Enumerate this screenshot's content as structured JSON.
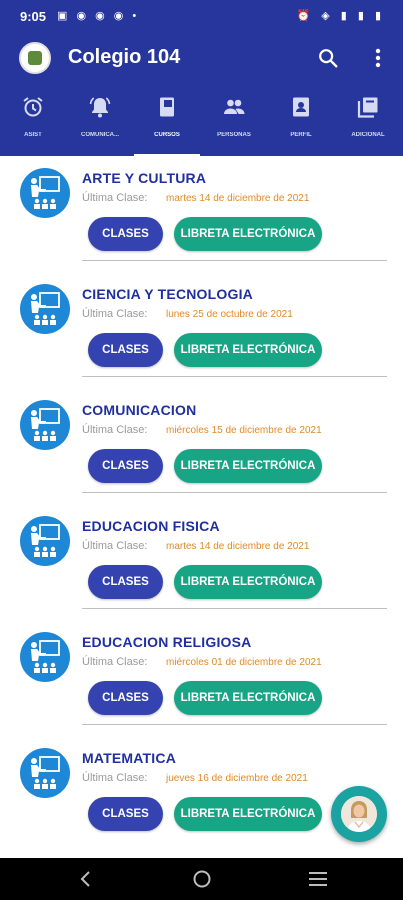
{
  "status_bar": {
    "time": "9:05",
    "notifications": "▣ ◉ ◉ ◉ •",
    "right": "⏰ ◈ ▮ ▮ ▮"
  },
  "app_bar": {
    "title": "Colegio 104"
  },
  "tabs": [
    {
      "label": "ASIST",
      "icon": "alarm-clock-icon"
    },
    {
      "label": "COMUNICA...",
      "icon": "bell-icon"
    },
    {
      "label": "CURSOS",
      "icon": "book-icon",
      "active": true
    },
    {
      "label": "PERSONAS",
      "icon": "people-icon"
    },
    {
      "label": "PERFIL",
      "icon": "profile-icon"
    },
    {
      "label": "ADICIONAL",
      "icon": "library-icon"
    }
  ],
  "courses": [
    {
      "name": "ARTE Y CULTURA",
      "last_class_label": "Última Clase:",
      "last_class_date": "martes 14 de diciembre de 2021",
      "clases_label": "CLASES",
      "libreta_label": "LIBRETA ELECTRÓNICA"
    },
    {
      "name": "CIENCIA Y TECNOLOGIA",
      "last_class_label": "Última Clase:",
      "last_class_date": "lunes 25 de octubre de 2021",
      "clases_label": "CLASES",
      "libreta_label": "LIBRETA ELECTRÓNICA"
    },
    {
      "name": "COMUNICACION",
      "last_class_label": "Última Clase:",
      "last_class_date": "miércoles 15 de diciembre de 2021",
      "clases_label": "CLASES",
      "libreta_label": "LIBRETA ELECTRÓNICA"
    },
    {
      "name": "EDUCACION FISICA",
      "last_class_label": "Última Clase:",
      "last_class_date": "martes 14 de diciembre de 2021",
      "clases_label": "CLASES",
      "libreta_label": "LIBRETA ELECTRÓNICA"
    },
    {
      "name": "EDUCACION RELIGIOSA",
      "last_class_label": "Última Clase:",
      "last_class_date": "miércoles 01 de diciembre de 2021",
      "clases_label": "CLASES",
      "libreta_label": "LIBRETA ELECTRÓNICA"
    },
    {
      "name": "MATEMATICA",
      "last_class_label": "Última Clase:",
      "last_class_date": "jueves 16 de diciembre de 2021",
      "clases_label": "CLASES",
      "libreta_label": "LIBRETA ELECTRÓNICA"
    }
  ],
  "colors": {
    "primary": "#27369c",
    "clases_button": "#3543b0",
    "libreta_button": "#17a585",
    "course_name": "#1f2fa0",
    "date": "#e08a2a"
  }
}
